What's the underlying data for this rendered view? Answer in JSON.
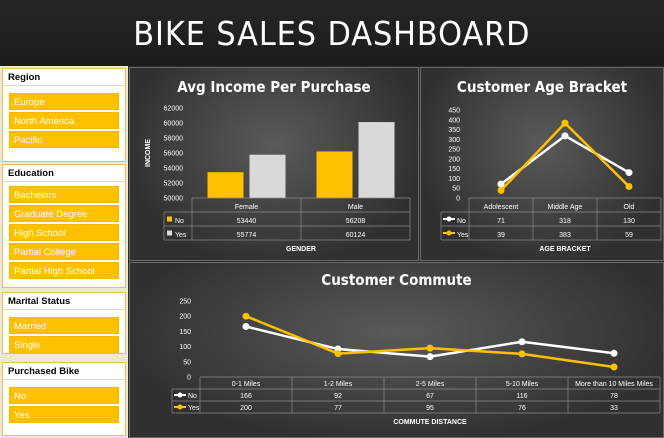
{
  "dashboard": {
    "title": "BIKE SALES DASHBOARD"
  },
  "slicers": [
    {
      "title": "Region",
      "items": [
        "Europe",
        "North America",
        "Pacific"
      ]
    },
    {
      "title": "Education",
      "items": [
        "Bachelors",
        "Graduate Degree",
        "High School",
        "Partial College",
        "Partial High School"
      ]
    },
    {
      "title": "Marital Status",
      "items": [
        "Married",
        "Single"
      ]
    },
    {
      "title": "Purchased Bike",
      "items": [
        "No",
        "Yes"
      ]
    }
  ],
  "colors": {
    "no": "#ffffff",
    "yes": "#ffc000",
    "bar_no": "#ffc000",
    "bar_yes": "#d9d9d9"
  },
  "chart_data": [
    {
      "type": "bar",
      "title": "Avg Income Per Purchase",
      "xlabel": "GENDER",
      "ylabel": "INCOME",
      "categories": [
        "Female",
        "Male"
      ],
      "series": [
        {
          "name": "No",
          "values": [
            53440,
            56208
          ]
        },
        {
          "name": "Yes",
          "values": [
            55774,
            60124
          ]
        }
      ],
      "ylim": [
        50000,
        62000
      ],
      "yticks": [
        "50000",
        "52000",
        "54000",
        "56000",
        "58000",
        "60000",
        "62000"
      ],
      "legend": "table-bottom"
    },
    {
      "type": "line",
      "title": "Customer Age Bracket",
      "xlabel": "AGE BRACKET",
      "ylabel": "",
      "categories": [
        "Adolescent",
        "Middle Age",
        "Old"
      ],
      "series": [
        {
          "name": "No",
          "values": [
            71,
            318,
            130
          ]
        },
        {
          "name": "Yes",
          "values": [
            39,
            383,
            59
          ]
        }
      ],
      "ylim": [
        0,
        450
      ],
      "yticks": [
        "0",
        "50",
        "100",
        "150",
        "200",
        "250",
        "300",
        "350",
        "400",
        "450"
      ],
      "legend": "table-bottom"
    },
    {
      "type": "line",
      "title": "Customer Commute",
      "xlabel": "COMMUTE DISTANCE",
      "ylabel": "",
      "categories": [
        "0-1 Miles",
        "1-2 Miles",
        "2-5 Miles",
        "5-10 Miles",
        "More than 10 Miles Miles"
      ],
      "series": [
        {
          "name": "No",
          "values": [
            166,
            92,
            67,
            116,
            78
          ]
        },
        {
          "name": "Yes",
          "values": [
            200,
            77,
            95,
            76,
            33
          ]
        }
      ],
      "ylim": [
        0,
        250
      ],
      "yticks": [
        "0",
        "50",
        "100",
        "150",
        "200",
        "250"
      ],
      "legend": "table-bottom"
    }
  ]
}
